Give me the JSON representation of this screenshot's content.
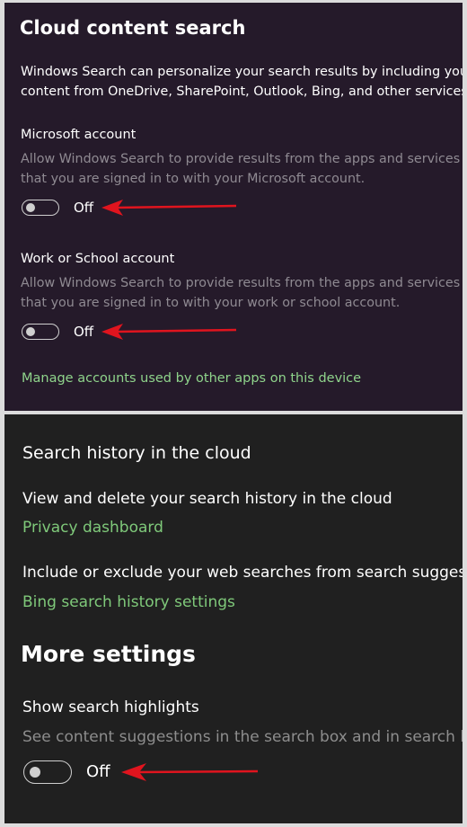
{
  "cloud_search": {
    "title": "Cloud content search",
    "intro_line1": "Windows Search can personalize your search results by including your",
    "intro_line2": "content from OneDrive, SharePoint, Outlook, Bing, and other services.",
    "microsoft": {
      "label": "Microsoft account",
      "desc_line1": "Allow Windows Search to provide results from the apps and services",
      "desc_line2": "that you are signed in to with your Microsoft account.",
      "toggle_state": "Off"
    },
    "work": {
      "label": "Work or School account",
      "desc_line1": "Allow Windows Search to provide results from the apps and services",
      "desc_line2": "that you are signed in to with your work or school account.",
      "toggle_state": "Off"
    },
    "manage_link": "Manage accounts used by other apps on this device"
  },
  "history": {
    "heading": "Search history in the cloud",
    "view_text": "View and delete your search history in the cloud",
    "privacy_link": "Privacy dashboard",
    "include_text": "Include or exclude your web searches from search suggest",
    "bing_link": "Bing search history settings"
  },
  "more_settings": {
    "title": "More settings",
    "highlights_label": "Show search highlights",
    "highlights_desc": "See content suggestions in the search box and in search ho",
    "toggle_state": "Off"
  },
  "colors": {
    "top_panel_bg": "#251a2a",
    "bottom_panel_bg": "#202020",
    "link_green": "#8fd48b",
    "annotation_arrow": "#e0141e"
  }
}
